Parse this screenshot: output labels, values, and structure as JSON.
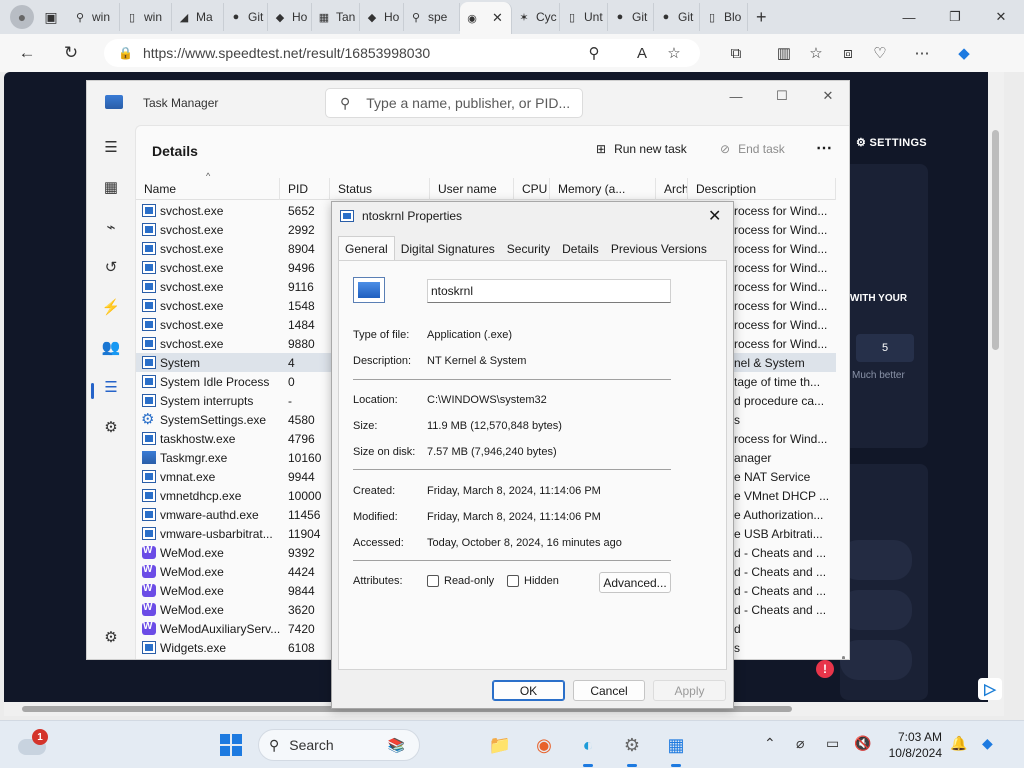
{
  "browser": {
    "tabs": [
      {
        "icon": "search-icon",
        "label": "win"
      },
      {
        "icon": "document-icon",
        "label": "win"
      },
      {
        "icon": "bing-icon",
        "label": "Ma"
      },
      {
        "icon": "github-icon",
        "label": "Git"
      },
      {
        "icon": "copilot-icon",
        "label": "Ho"
      },
      {
        "icon": "windows-logo-icon",
        "label": "Tan"
      },
      {
        "icon": "copilot-icon",
        "label": "Ho"
      },
      {
        "icon": "search-icon",
        "label": "spe"
      },
      {
        "icon": "speedtest-icon",
        "label": "",
        "active": true
      },
      {
        "icon": "cyclone-icon",
        "label": "Cyc"
      },
      {
        "icon": "document-icon",
        "label": "Unt"
      },
      {
        "icon": "github-icon",
        "label": "Git"
      },
      {
        "icon": "github-icon",
        "label": "Git"
      },
      {
        "icon": "document-icon",
        "label": "Blo"
      }
    ],
    "url": "https://www.speedtest.net/result/16853998030"
  },
  "webpage": {
    "settings_label": "SETTINGS",
    "with_your": "WITH YOUR",
    "rating_value": "5",
    "much_better": "Much better"
  },
  "task_manager": {
    "title": "Task Manager",
    "search_placeholder": "Type a name, publisher, or PID...",
    "heading": "Details",
    "run_new_task": "Run new task",
    "end_task": "End task",
    "columns": [
      "Name",
      "PID",
      "Status",
      "User name",
      "CPU",
      "Memory (a...",
      "Archite...",
      "Description"
    ],
    "rows": [
      {
        "name": "svchost.exe",
        "pid": "5652",
        "desc": "rocess for Wind...",
        "icon": "std"
      },
      {
        "name": "svchost.exe",
        "pid": "2992",
        "desc": "rocess for Wind...",
        "icon": "std"
      },
      {
        "name": "svchost.exe",
        "pid": "8904",
        "desc": "rocess for Wind...",
        "icon": "std"
      },
      {
        "name": "svchost.exe",
        "pid": "9496",
        "desc": "rocess for Wind...",
        "icon": "std"
      },
      {
        "name": "svchost.exe",
        "pid": "9116",
        "desc": "rocess for Wind...",
        "icon": "std"
      },
      {
        "name": "svchost.exe",
        "pid": "1548",
        "desc": "rocess for Wind...",
        "icon": "std"
      },
      {
        "name": "svchost.exe",
        "pid": "1484",
        "desc": "rocess for Wind...",
        "icon": "std"
      },
      {
        "name": "svchost.exe",
        "pid": "9880",
        "desc": "rocess for Wind...",
        "icon": "std"
      },
      {
        "name": "System",
        "pid": "4",
        "desc": "nel & System",
        "icon": "std",
        "selected": true
      },
      {
        "name": "System Idle Process",
        "pid": "0",
        "desc": "tage of time th...",
        "icon": "std"
      },
      {
        "name": "System interrupts",
        "pid": "-",
        "desc": "d procedure ca...",
        "icon": "std"
      },
      {
        "name": "SystemSettings.exe",
        "pid": "4580",
        "desc": "s",
        "icon": "gear"
      },
      {
        "name": "taskhostw.exe",
        "pid": "4796",
        "desc": "rocess for Wind...",
        "icon": "std"
      },
      {
        "name": "Taskmgr.exe",
        "pid": "10160",
        "desc": "anager",
        "icon": "chart"
      },
      {
        "name": "vmnat.exe",
        "pid": "9944",
        "desc": "e NAT Service",
        "icon": "std"
      },
      {
        "name": "vmnetdhcp.exe",
        "pid": "10000",
        "desc": "e VMnet DHCP ...",
        "icon": "std"
      },
      {
        "name": "vmware-authd.exe",
        "pid": "11456",
        "desc": "e Authorization...",
        "icon": "std"
      },
      {
        "name": "vmware-usbarbitrat...",
        "pid": "11904",
        "desc": "e USB Arbitrati...",
        "icon": "std"
      },
      {
        "name": "WeMod.exe",
        "pid": "9392",
        "desc": "d - Cheats and ...",
        "icon": "wemod"
      },
      {
        "name": "WeMod.exe",
        "pid": "4424",
        "desc": "d - Cheats and ...",
        "icon": "wemod"
      },
      {
        "name": "WeMod.exe",
        "pid": "9844",
        "desc": "d - Cheats and ...",
        "icon": "wemod"
      },
      {
        "name": "WeMod.exe",
        "pid": "3620",
        "desc": "d - Cheats and ...",
        "icon": "wemod"
      },
      {
        "name": "WeModAuxiliaryServ...",
        "pid": "7420",
        "desc": "d",
        "icon": "wemod"
      },
      {
        "name": "Widgets.exe",
        "pid": "6108",
        "desc": "s",
        "icon": "std"
      }
    ]
  },
  "properties": {
    "title": "ntoskrnl Properties",
    "tabs": [
      "General",
      "Digital Signatures",
      "Security",
      "Details",
      "Previous Versions"
    ],
    "file_name": "ntoskrnl",
    "type_label": "Type of file:",
    "type_value": "Application (.exe)",
    "desc_label": "Description:",
    "desc_value": "NT Kernel & System",
    "location_label": "Location:",
    "location_value": "C:\\WINDOWS\\system32",
    "size_label": "Size:",
    "size_value": "11.9 MB (12,570,848 bytes)",
    "size_disk_label": "Size on disk:",
    "size_disk_value": "7.57 MB (7,946,240 bytes)",
    "created_label": "Created:",
    "created_value": "Friday, March 8, 2024, 11:14:06 PM",
    "modified_label": "Modified:",
    "modified_value": "Friday, March 8, 2024, 11:14:06 PM",
    "accessed_label": "Accessed:",
    "accessed_value": "Today, October 8, 2024, 16 minutes ago",
    "attributes_label": "Attributes:",
    "readonly_label": "Read-only",
    "hidden_label": "Hidden",
    "advanced_label": "Advanced...",
    "ok_label": "OK",
    "cancel_label": "Cancel",
    "apply_label": "Apply"
  },
  "taskbar": {
    "weather_badge": "1",
    "search_label": "Search",
    "time": "7:03 AM",
    "date": "10/8/2024"
  }
}
